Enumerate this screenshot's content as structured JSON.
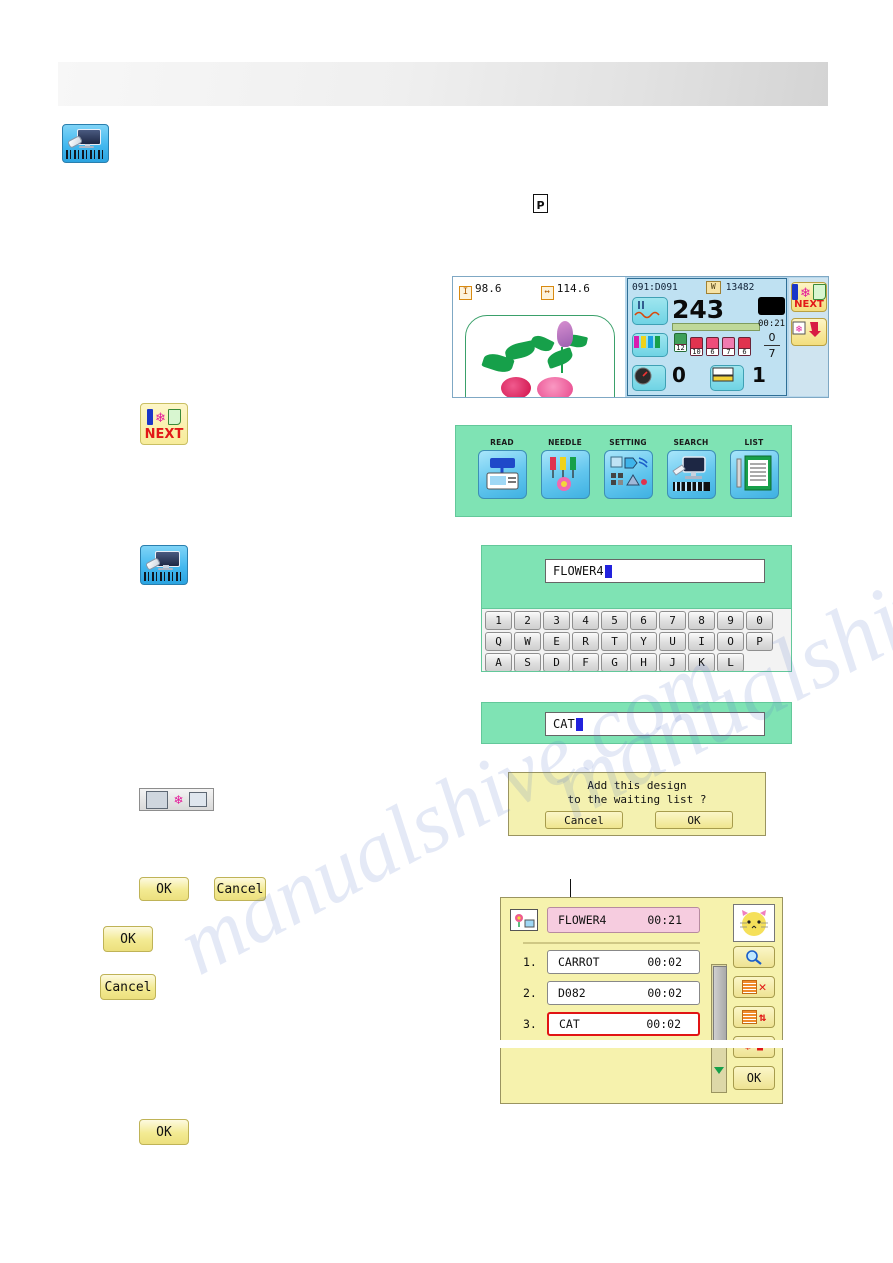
{
  "header": {
    "band_label": ""
  },
  "top_icons": {
    "barcode_reader": "barcode-reader-icon",
    "p_glyph": "P"
  },
  "status_screen": {
    "design_height": "98.6",
    "design_width": "114.6",
    "design_code": "091:D091",
    "stitch_count": "13482",
    "stitch_label": "W",
    "current_stitches": "243",
    "elapsed_time": "00:21",
    "needle_number": "12",
    "needle_bars": [
      "10",
      "6",
      "7",
      "6"
    ],
    "frame_numerator": "0",
    "frame_denominator": "7",
    "speed_value": "0",
    "frame_value": "1",
    "side_button_next": "NEXT"
  },
  "menu_panel": {
    "items": [
      {
        "label": "READ",
        "icon": "read-icon"
      },
      {
        "label": "NEEDLE",
        "icon": "needle-icon"
      },
      {
        "label": "SETTING",
        "icon": "setting-icon"
      },
      {
        "label": "SEARCH",
        "icon": "search-icon"
      },
      {
        "label": "LIST",
        "icon": "list-icon"
      }
    ]
  },
  "name_entry": {
    "value": "FLOWER4",
    "keyboard_rows": [
      [
        "1",
        "2",
        "3",
        "4",
        "5",
        "6",
        "7",
        "8",
        "9",
        "0"
      ],
      [
        "Q",
        "W",
        "E",
        "R",
        "T",
        "Y",
        "U",
        "I",
        "O",
        "P"
      ],
      [
        "A",
        "S",
        "D",
        "F",
        "G",
        "H",
        "J",
        "K",
        "L"
      ]
    ]
  },
  "name_entry2": {
    "value": "CAT"
  },
  "confirm_dialog": {
    "line1": "Add this design",
    "line2": "to the waiting list ?",
    "cancel_label": "Cancel",
    "ok_label": "OK"
  },
  "waiting_list": {
    "current": {
      "name": "FLOWER4",
      "time": "00:21"
    },
    "rows": [
      {
        "index": "1.",
        "name": "CARROT",
        "time": "00:02",
        "selected": false
      },
      {
        "index": "2.",
        "name": "D082",
        "time": "00:02",
        "selected": false
      },
      {
        "index": "3.",
        "name": "CAT",
        "time": "00:02",
        "selected": true
      }
    ],
    "ok_label": "OK",
    "buttons": {
      "preview": "design-preview-thumbnail",
      "zoom": "magnifier-icon",
      "delete": "list-delete-icon",
      "reorder": "list-reorder-icon"
    }
  },
  "left_column": {
    "icon_barcode_top": "barcode-reader-icon",
    "icon_next": "next-icon",
    "icon_barcode_mid": "barcode-reader-icon",
    "icon_transfer": "machine-to-pc-transfer-icon",
    "ok_label": "OK",
    "cancel_label": "Cancel",
    "ok_label2": "OK",
    "cancel_label2": "Cancel",
    "ok_label3": "OK"
  },
  "watermark": {
    "line1": "manualshive.com",
    "line2": "manualshive.com"
  },
  "colors": {
    "green_panel": "#7fe3b4",
    "yellow_panel": "#f6f2ad",
    "pink_row": "#f6ccdf",
    "red_select": "#e11414",
    "blue_tile": "#43b8ef"
  }
}
